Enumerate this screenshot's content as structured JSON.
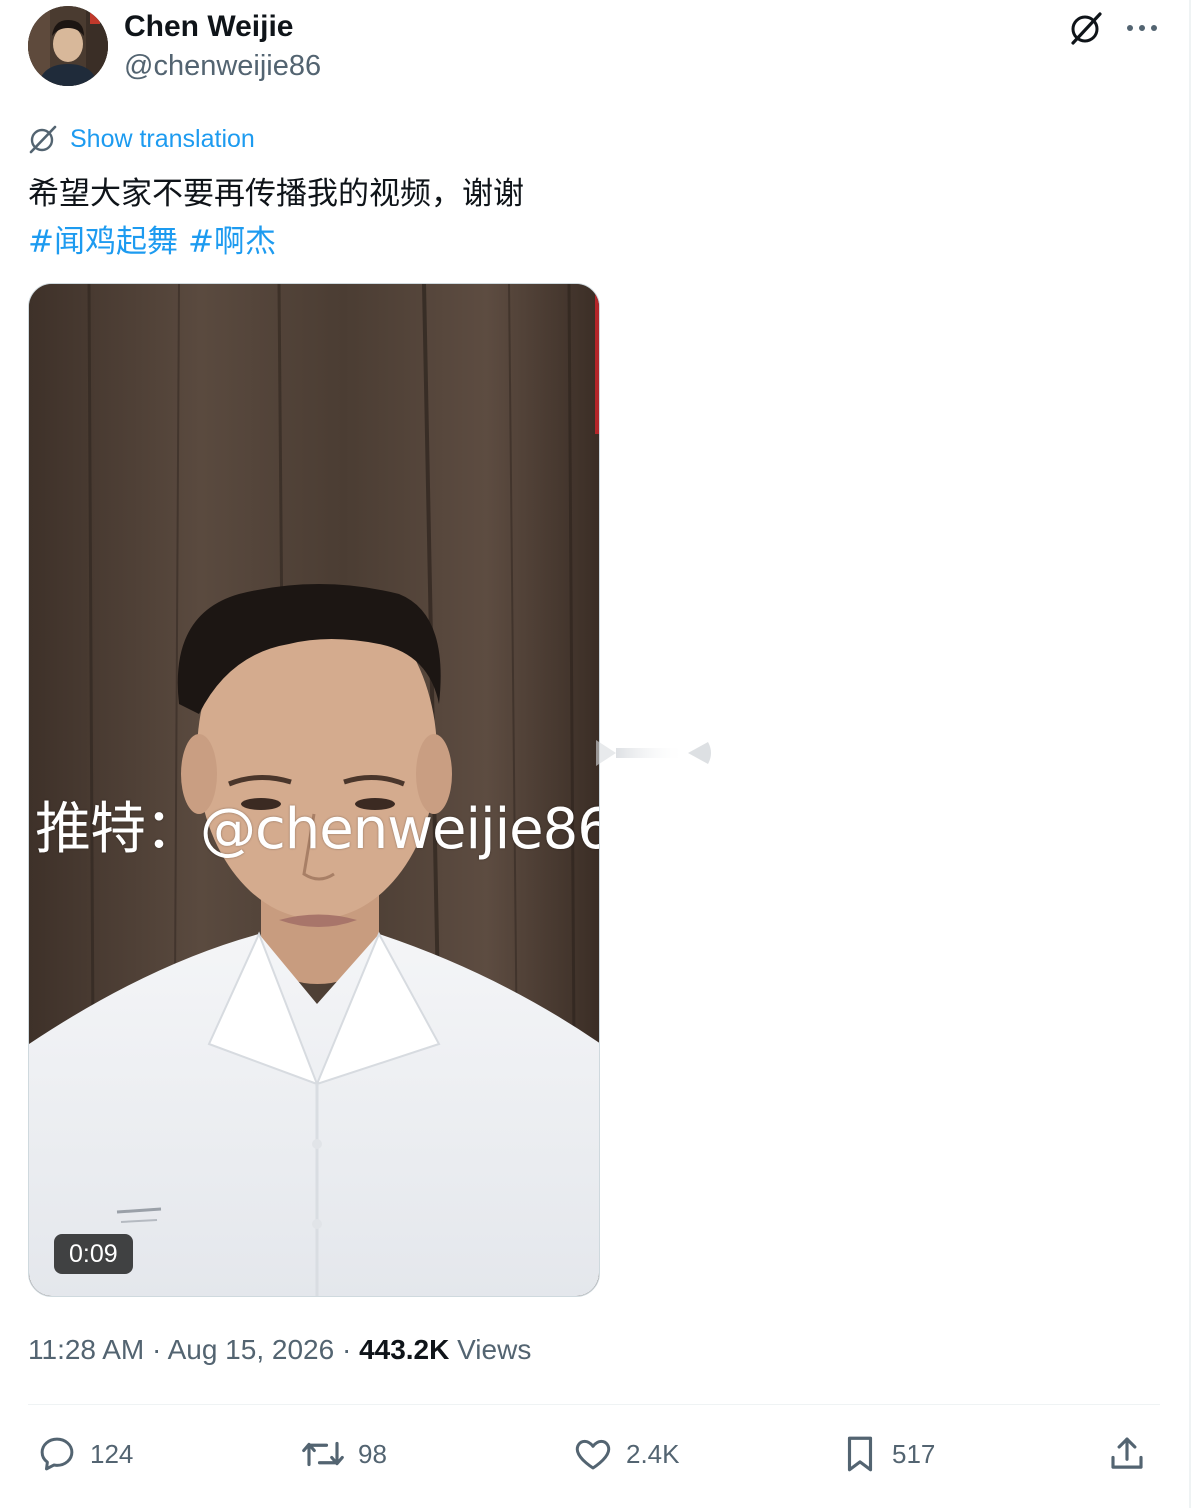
{
  "author": {
    "display_name": "Chen Weijie",
    "handle": "@chenweijie86"
  },
  "translation": {
    "label": "Show translation"
  },
  "tweet": {
    "text": "希望大家不要再传播我的视频，谢谢",
    "hashtags": [
      "#闻鸡起舞",
      "#啊杰"
    ]
  },
  "media": {
    "overlay_text": "推特：@chenweijie86",
    "duration": "0:09"
  },
  "meta": {
    "time": "11:28 AM",
    "separator": "·",
    "date": "Aug 15, 2026",
    "views_count": "443.2K",
    "views_label": "Views"
  },
  "actions": {
    "replies": "124",
    "reposts": "98",
    "likes": "2.4K",
    "bookmarks": "517"
  },
  "icons": {
    "grok": "grok-icon",
    "more": "more-icon",
    "translate": "translate-icon",
    "reply": "reply-icon",
    "repost": "repost-icon",
    "like": "heart-icon",
    "bookmark": "bookmark-icon",
    "share": "share-icon"
  },
  "colors": {
    "link": "#1d9bf0",
    "secondary_text": "#536471",
    "primary_text": "#0f1419"
  }
}
